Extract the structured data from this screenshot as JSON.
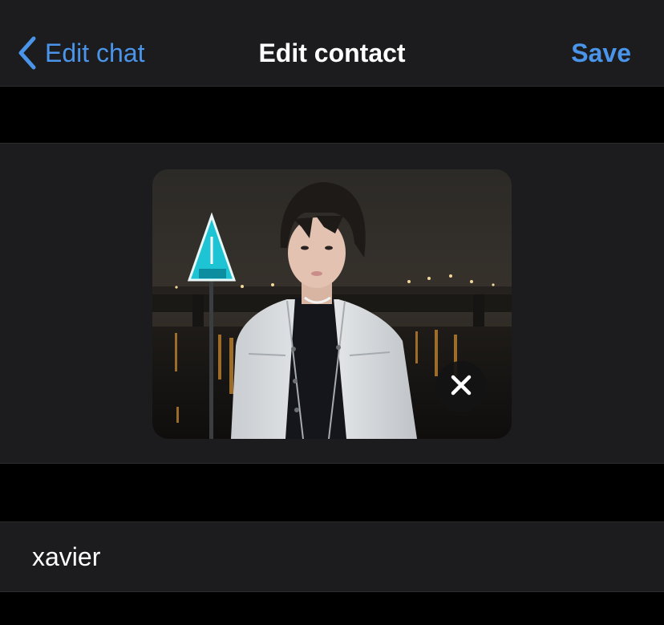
{
  "navbar": {
    "back_label": "Edit chat",
    "title": "Edit contact",
    "save_label": "Save"
  },
  "contact": {
    "name_value": "xavier"
  },
  "icons": {
    "back": "chevron-left-icon",
    "remove_photo": "close-icon"
  },
  "colors": {
    "accent": "#4a95ea",
    "background": "#000000",
    "cell": "#1c1c1e",
    "text": "#ffffff"
  }
}
